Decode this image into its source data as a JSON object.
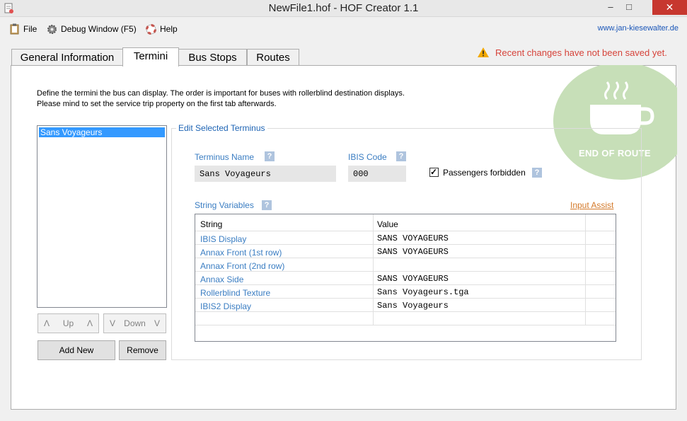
{
  "window": {
    "title": "NewFile1.hof - HOF Creator 1.1",
    "minimize": "–",
    "maximize": "□",
    "close": "✕"
  },
  "menu": {
    "file": "File",
    "debug": "Debug Window (F5)",
    "help": "Help",
    "website": "www.jan-kiesewalter.de"
  },
  "tabs": [
    "General Information",
    "Termini",
    "Bus Stops",
    "Routes"
  ],
  "active_tab": "Termini",
  "warning": "Recent changes have not been saved yet.",
  "logo_text": "END OF ROUTE",
  "intro": {
    "line1": "Define the termini the bus can display. The order is important for buses with rollerblind destination displays.",
    "line2": "Please mind to set the service trip property on the first tab afterwards."
  },
  "termini_list": [
    "Sans Voyageurs"
  ],
  "buttons": {
    "up_left": "Λ",
    "up": "Up",
    "up_right": "Λ",
    "down_left": "V",
    "down": "Down",
    "down_right": "V",
    "add_new": "Add New",
    "remove": "Remove"
  },
  "edit": {
    "group_title": "Edit Selected Terminus",
    "terminus_name_label": "Terminus Name",
    "terminus_name": "Sans Voyageurs",
    "ibis_code_label": "IBIS Code",
    "ibis_code": "000",
    "passengers_forbidden_label": "Passengers forbidden",
    "passengers_forbidden": true,
    "help_glyph": "?",
    "check_glyph": "✓",
    "string_variables_label": "String Variables",
    "input_assist": "Input Assist"
  },
  "table": {
    "columns": [
      "String",
      "Value"
    ],
    "rows": [
      {
        "string": "IBIS Display",
        "value": "SANS VOYAGEURS"
      },
      {
        "string": "Annax Front (1st row)",
        "value": "SANS VOYAGEURS"
      },
      {
        "string": "Annax Front (2nd row)",
        "value": ""
      },
      {
        "string": "Annax Side",
        "value": "SANS VOYAGEURS"
      },
      {
        "string": "Rollerblind Texture",
        "value": "Sans Voyageurs.tga"
      },
      {
        "string": "IBIS2 Display",
        "value": "Sans Voyageurs"
      }
    ]
  }
}
